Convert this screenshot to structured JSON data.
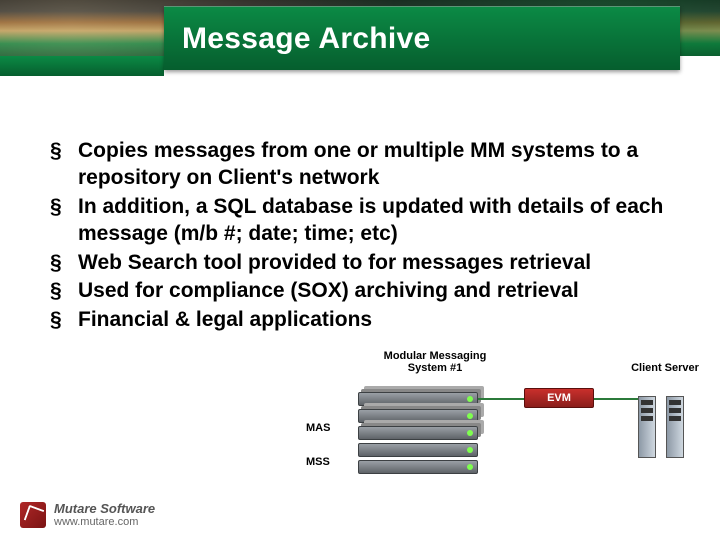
{
  "title": "Message Archive",
  "bullets": [
    "Copies messages from one or multiple MM systems to a repository on Client's network",
    "In addition, a SQL database is updated with details of each message (m/b #; date; time; etc)",
    "Web Search tool provided to for messages retrieval",
    "Used for compliance (SOX) archiving and retrieval",
    "Financial & legal applications"
  ],
  "diagram": {
    "mm_title": "Modular Messaging System #1",
    "mas": "MAS",
    "mss": "MSS",
    "evm": "EVM",
    "client": "Client Server"
  },
  "footer": {
    "brand": "Mutare Software",
    "url": "www.mutare.com"
  }
}
